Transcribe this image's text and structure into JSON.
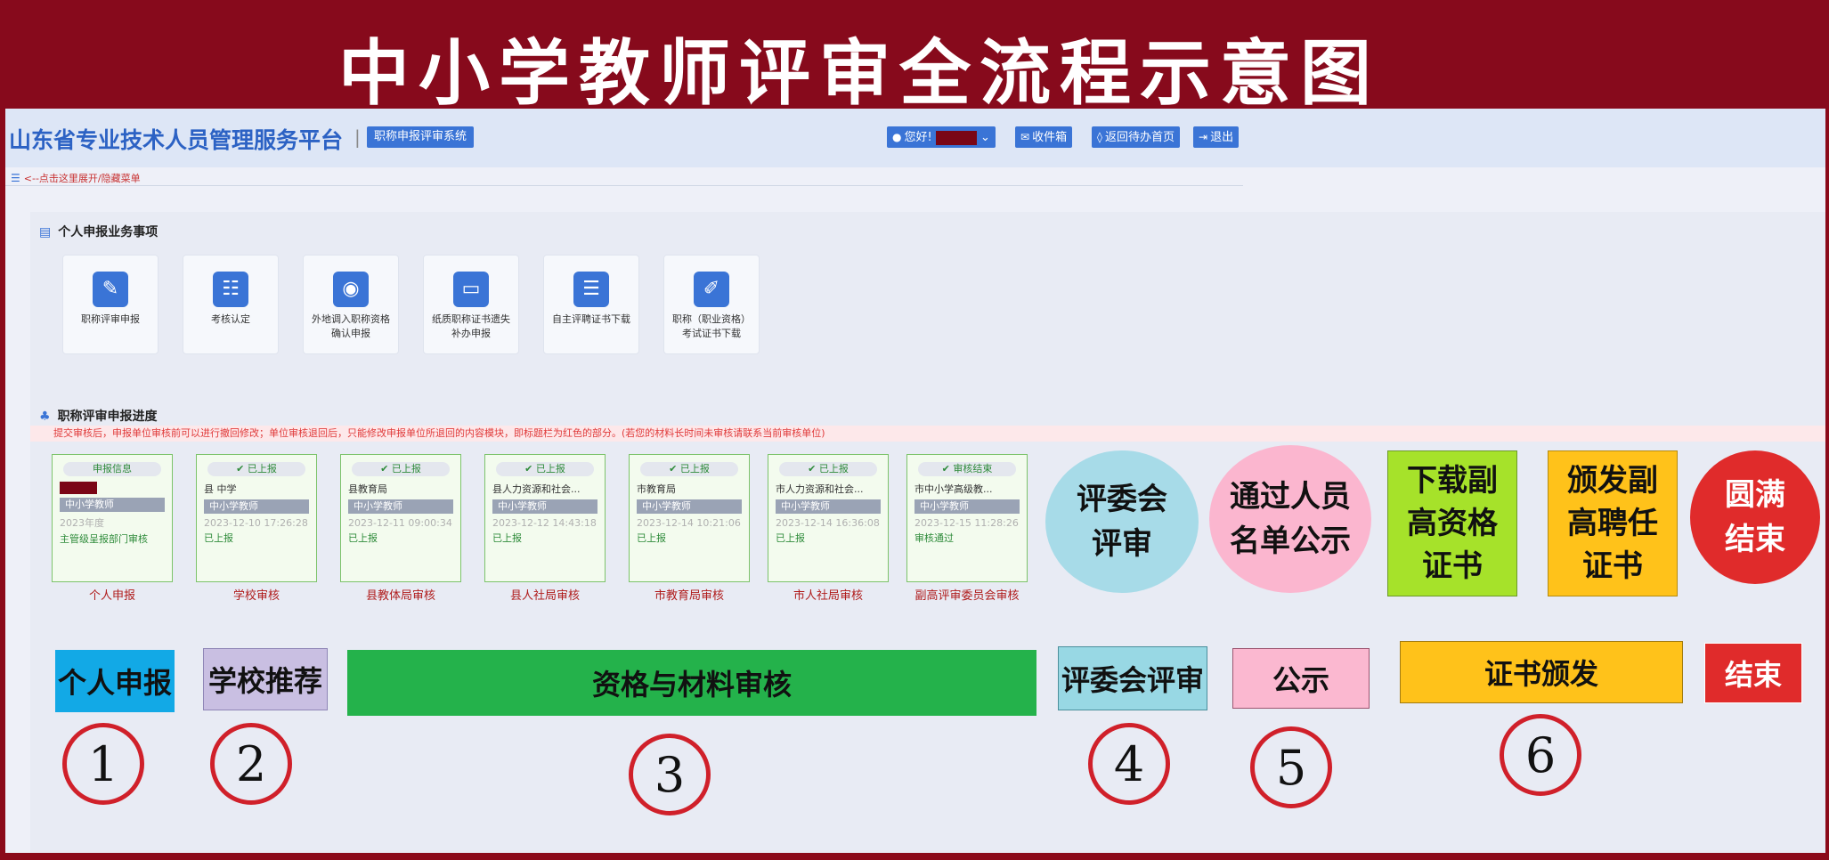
{
  "banner": {
    "title": "中小学教师评审全流程示意图"
  },
  "topbar": {
    "platform_title": "山东省专业技术人员管理服务平台",
    "separator": "|",
    "system_badge": "职称申报评审系统",
    "greeting": "您好!",
    "inbox": "收件箱",
    "back_home": "返回待办首页",
    "logout": "退出"
  },
  "menu_toggle": "<--点击这里展开/隐藏菜单",
  "business": {
    "title": "个人申报业务事项",
    "items": [
      {
        "label": "职称评审申报",
        "icon": "document-edit-icon"
      },
      {
        "label": "考核认定",
        "icon": "user-document-icon"
      },
      {
        "label": "外地调入职称资格确认申报",
        "icon": "map-pin-icon"
      },
      {
        "label": "纸质职称证书遗失补办申报",
        "icon": "id-card-icon"
      },
      {
        "label": "自主评聘证书下载",
        "icon": "user-list-icon"
      },
      {
        "label": "职称（职业资格）考试证书下载",
        "icon": "pencil-edit-icon"
      }
    ]
  },
  "progress": {
    "title": "职称评审申报进度",
    "notice": "提交审核后，申报单位审核前可以进行撤回修改；单位审核退回后，只能修改申报单位所退回的内容模块，即标题栏为红色的部分。(若您的材料长时间未审核请联系当前审核单位)",
    "cards": [
      {
        "head": "申报信息",
        "name": "",
        "role": "中小学教师",
        "time": "2023年度",
        "status": "主管级呈报部门审核",
        "caption": "个人申报"
      },
      {
        "head": "✔ 已上报",
        "name": "县        中学",
        "role": "中小学教师",
        "time": "2023-12-10 17:26:28",
        "status": "已上报",
        "caption": "学校审核"
      },
      {
        "head": "✔ 已上报",
        "name": "县教育局",
        "role": "中小学教师",
        "time": "2023-12-11 09:00:34",
        "status": "已上报",
        "caption": "县教体局审核"
      },
      {
        "head": "✔ 已上报",
        "name": "县人力资源和社会...",
        "role": "中小学教师",
        "time": "2023-12-12 14:43:18",
        "status": "已上报",
        "caption": "县人社局审核"
      },
      {
        "head": "✔ 已上报",
        "name": "市教育局",
        "role": "中小学教师",
        "time": "2023-12-14 10:21:06",
        "status": "已上报",
        "caption": "市教育局审核"
      },
      {
        "head": "✔ 已上报",
        "name": "市人力资源和社会...",
        "role": "中小学教师",
        "time": "2023-12-14 16:36:08",
        "status": "已上报",
        "caption": "市人社局审核"
      },
      {
        "head": "✔ 审核结束",
        "name": "市中小学高级教...",
        "role": "中小学教师",
        "time": "2023-12-15 11:28:26",
        "status": "审核通过",
        "caption": "副高评审委员会审核"
      }
    ]
  },
  "stages": {
    "review_committee": "评委会评审",
    "publicity": "通过人员名单公示",
    "download_cert": "下载副高资格证书",
    "issue_cert": "颁发副高聘任证书",
    "complete": "圆满结束"
  },
  "phases": [
    {
      "label": "个人申报",
      "number": "1",
      "color": "#12a9e6"
    },
    {
      "label": "学校推荐",
      "number": "2",
      "color": "#c9bfe2"
    },
    {
      "label": "资格与材料审核",
      "number": "3",
      "color": "#24b24b"
    },
    {
      "label": "评委会评审",
      "number": "4",
      "color": "#98d8e4"
    },
    {
      "label": "公示",
      "number": "5",
      "color": "#fbb8d0"
    },
    {
      "label": "证书颁发",
      "number": "6",
      "color": "#ffc21a"
    },
    {
      "label": "结束",
      "color": "#e02b2b"
    }
  ],
  "colors": {
    "banner_bg": "#870a1c",
    "brand_blue": "#3a74d6",
    "review_circle": "#a7dbe8",
    "publicity_circle": "#fbb6cf",
    "download_box": "#a6e22a",
    "issue_box": "#ffc21a",
    "complete_circle": "#e02b2b"
  }
}
